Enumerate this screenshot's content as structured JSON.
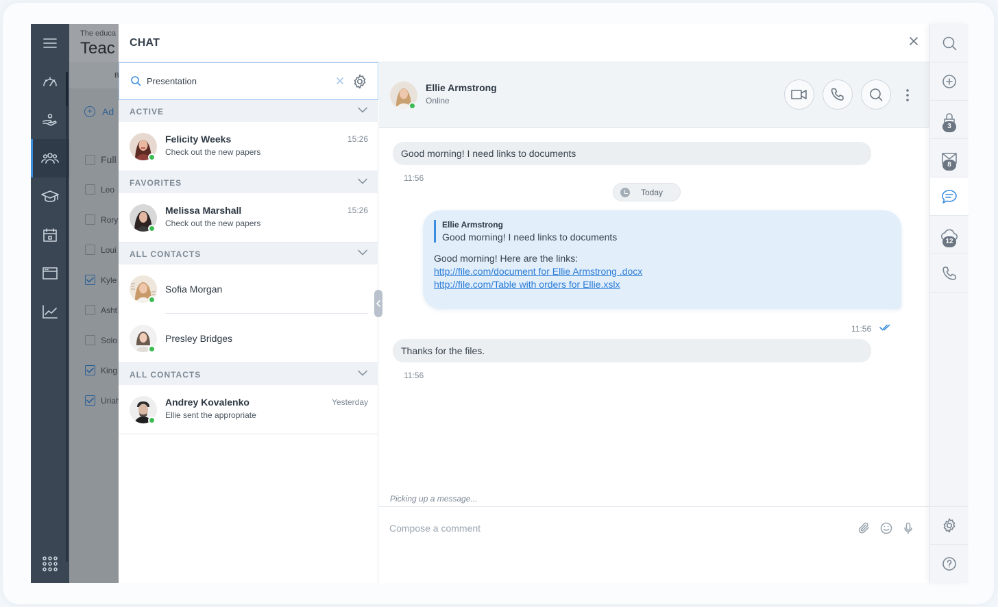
{
  "background_page": {
    "subtitle": "The educa",
    "title": "Teac",
    "bar_letter": "B",
    "add_label": "Ad",
    "rows": [
      "Full",
      "Leo",
      "Rory",
      "Loui",
      "Kyle",
      "Asht",
      "Solo",
      "King",
      "Uriah"
    ]
  },
  "chat": {
    "title": "CHAT",
    "search": {
      "value": "Presentation"
    },
    "sections": {
      "active": "ACTIVE",
      "favorites": "FAVORITES",
      "all_contacts_1": "ALL CONTACTS",
      "all_contacts_2": "ALL CONTACTS"
    },
    "contacts": [
      {
        "name": "Felicity Weeks",
        "message": "Check out the new papers",
        "time": "15:26"
      },
      {
        "name": "Melissa Marshall",
        "message": "Check out the new papers",
        "time": "15:26"
      },
      {
        "name": "Sofia Morgan"
      },
      {
        "name": "Presley Bridges"
      },
      {
        "name": "Andrey Kovalenko",
        "message": "Ellie sent the appropriate",
        "time": "Yesterday"
      }
    ],
    "conversation": {
      "name": "Ellie Armstrong",
      "status": "Online",
      "messages": [
        {
          "text": "Good morning! I need links to documents",
          "time": "11:56"
        },
        {
          "quote_author": "Ellie Armstrong",
          "quote_text": "Good morning! I need links to documents",
          "text": "Good morning! Here are the links:",
          "link1": "http://file.com/document for Ellie Armstrong .docx",
          "link2": "http://file.com/Table with orders for Ellie.xslx",
          "time": "11:56"
        },
        {
          "text": "Thanks for the files.",
          "time": "11:56"
        }
      ],
      "day_separator": "Today",
      "typing": "Picking up a message...",
      "composer_placeholder": "Compose a comment"
    }
  },
  "rightbar": {
    "lock_badge": "3",
    "mail_badge": "8",
    "cloud_badge": "12"
  },
  "colors": {
    "accent": "#3b8ede",
    "sidebar": "#3a4654",
    "online": "#3dbb53",
    "outgoing_bubble": "#e2effb"
  }
}
